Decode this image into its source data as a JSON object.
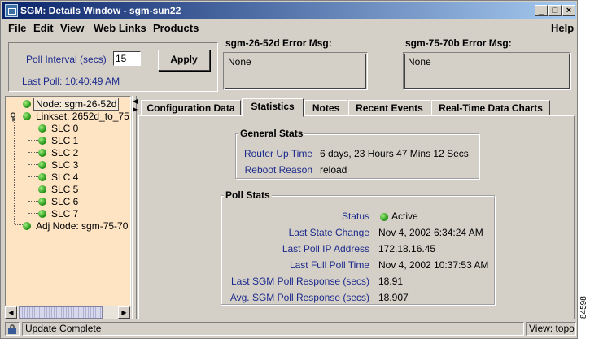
{
  "window": {
    "title": "SGM: Details Window - sgm-sun22",
    "controls": {
      "minimize": "_",
      "maximize": "□",
      "close": "×"
    }
  },
  "menu": {
    "items": [
      {
        "pre": "",
        "key": "F",
        "post": "ile"
      },
      {
        "pre": "",
        "key": "E",
        "post": "dit"
      },
      {
        "pre": "",
        "key": "V",
        "post": "iew"
      },
      {
        "pre": "",
        "key": "W",
        "post": "eb Links"
      },
      {
        "pre": "",
        "key": "P",
        "post": "roducts"
      }
    ],
    "help": {
      "pre": "",
      "key": "H",
      "post": "elp"
    }
  },
  "poll": {
    "interval_label": "Poll Interval (secs)",
    "interval_value": "15",
    "apply_label": "Apply",
    "last_poll": "Last Poll:  10:40:49 AM"
  },
  "errors": [
    {
      "label": "sgm-26-52d  Error Msg:",
      "message": "None"
    },
    {
      "label": "sgm-75-70b  Error Msg:",
      "message": "None"
    }
  ],
  "tree": {
    "node": "Node: sgm-26-52d",
    "linkset": "Linkset: 2652d_to_75",
    "slcs": [
      "SLC 0",
      "SLC 1",
      "SLC 2",
      "SLC 3",
      "SLC 4",
      "SLC 5",
      "SLC 6",
      "SLC 7"
    ],
    "adj_node": "Adj Node: sgm-75-70"
  },
  "tabs": [
    {
      "label": "Configuration Data",
      "active": false
    },
    {
      "label": "Statistics",
      "active": true
    },
    {
      "label": "Notes",
      "active": false
    },
    {
      "label": "Recent Events",
      "active": false
    },
    {
      "label": "Real-Time Data Charts",
      "active": false
    }
  ],
  "general_stats": {
    "title": "General Stats",
    "rows": [
      {
        "label": "Router Up Time",
        "value": "6 days, 23 Hours 47 Mins 12 Secs"
      },
      {
        "label": "Reboot Reason",
        "value": "reload"
      }
    ]
  },
  "poll_stats": {
    "title": "Poll Stats",
    "rows": [
      {
        "label": "Status",
        "value": "Active",
        "status_color": "#2ca01c"
      },
      {
        "label": "Last State Change",
        "value": "Nov 4, 2002 6:34:24 AM"
      },
      {
        "label": "Last Poll IP Address",
        "value": "172.18.16.45"
      },
      {
        "label": "Last Full Poll Time",
        "value": "Nov 4, 2002 10:37:53 AM"
      },
      {
        "label": "Last SGM Poll Response (secs)",
        "value": "18.91"
      },
      {
        "label": "Avg. SGM Poll Response (secs)",
        "value": "18.907"
      }
    ]
  },
  "statusbar": {
    "message": "Update Complete",
    "view": "View: topo"
  },
  "figure_id": "84598",
  "colors": {
    "label_blue": "#1c2a8c",
    "tree_bg": "#ffe4c4",
    "title_gradient_start": "#0a246a"
  }
}
